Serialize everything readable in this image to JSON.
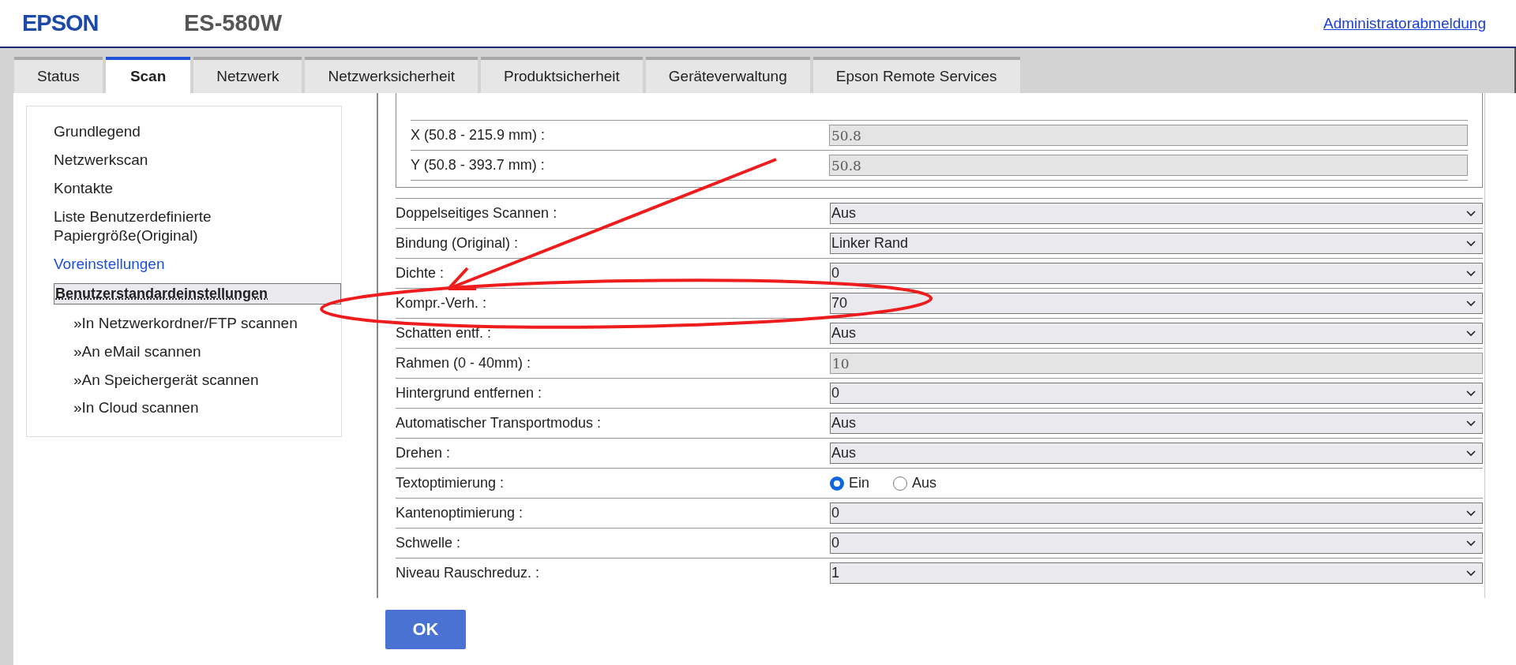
{
  "header": {
    "logo": "EPSON",
    "model": "ES-580W",
    "logout_link": "Administratorabmeldung"
  },
  "tabs": [
    {
      "label": "Status",
      "selected": false
    },
    {
      "label": "Scan",
      "selected": true
    },
    {
      "label": "Netzwerk",
      "selected": false
    },
    {
      "label": "Netzwerksicherheit",
      "selected": false
    },
    {
      "label": "Produktsicherheit",
      "selected": false
    },
    {
      "label": "Geräteverwaltung",
      "selected": false
    },
    {
      "label": "Epson Remote Services",
      "selected": false
    }
  ],
  "sidebar": {
    "items": [
      {
        "label": "Grundlegend",
        "selected": false,
        "hovered": false
      },
      {
        "label": "Netzwerkscan",
        "selected": false,
        "hovered": false
      },
      {
        "label": "Kontakte",
        "selected": false,
        "hovered": false
      },
      {
        "label": "Liste Benutzerdefinierte Papiergröße(Original)",
        "selected": false,
        "hovered": false
      },
      {
        "label": "Voreinstellungen",
        "selected": false,
        "hovered": true
      },
      {
        "label": "Benutzerstandardeinstellungen",
        "selected": true,
        "hovered": false,
        "children": [
          {
            "label": "»In Netzwerkordner/FTP scannen"
          },
          {
            "label": "»An eMail scannen"
          },
          {
            "label": "»An Speichergerät scannen"
          },
          {
            "label": "»In Cloud scannen"
          }
        ]
      }
    ]
  },
  "form": {
    "size_fields": [
      {
        "label": "X (50.8 - 215.9 mm) :",
        "value": "50.8",
        "disabled": true
      },
      {
        "label": "Y (50.8 - 393.7 mm) :",
        "value": "50.8",
        "disabled": true
      }
    ],
    "rows": [
      {
        "label": "Doppelseitiges Scannen :",
        "kind": "select",
        "value": "Aus"
      },
      {
        "label": "Bindung (Original) :",
        "kind": "select",
        "value": "Linker Rand"
      },
      {
        "label": "Dichte :",
        "kind": "select",
        "value": "0"
      },
      {
        "label": "Kompr.-Verh. :",
        "kind": "select",
        "value": "70"
      },
      {
        "label": "Schatten entf. :",
        "kind": "select",
        "value": "Aus"
      },
      {
        "label": "Rahmen (0 - 40mm) :",
        "kind": "input",
        "value": "10",
        "disabled": true
      },
      {
        "label": "Hintergrund entfernen :",
        "kind": "select",
        "value": "0"
      },
      {
        "label": "Automatischer Transportmodus :",
        "kind": "select",
        "value": "Aus"
      },
      {
        "label": "Drehen :",
        "kind": "select",
        "value": "Aus"
      },
      {
        "label": "Textoptimierung :",
        "kind": "radio",
        "options": [
          {
            "label": "Ein",
            "selected": true
          },
          {
            "label": "Aus",
            "selected": false
          }
        ]
      },
      {
        "label": "Kantenoptimierung :",
        "kind": "select",
        "value": "0"
      },
      {
        "label": "Schwelle :",
        "kind": "select",
        "value": "0"
      },
      {
        "label": "Niveau Rauschreduz. :",
        "kind": "select",
        "value": "1"
      }
    ]
  },
  "ok_button": "OK"
}
